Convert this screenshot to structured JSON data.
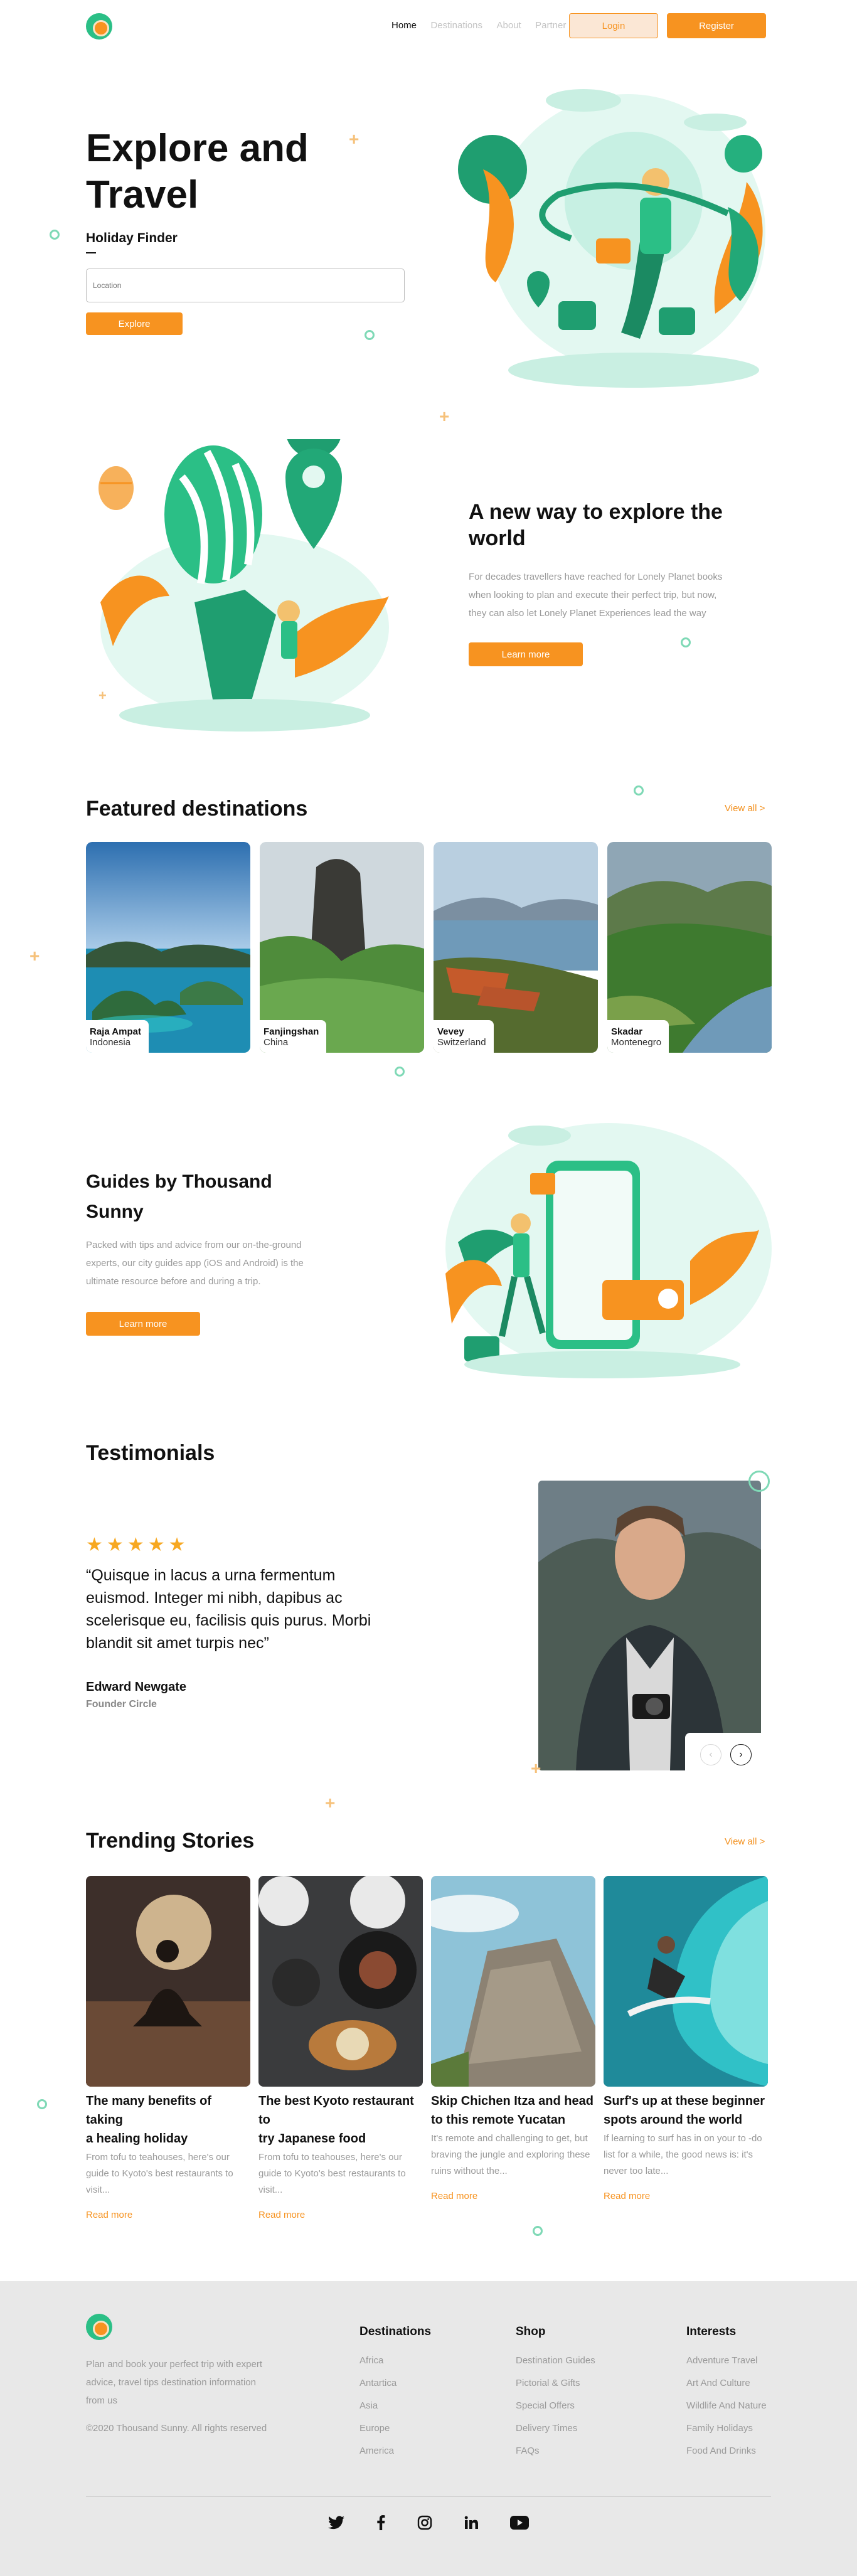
{
  "header": {
    "nav": [
      "Home",
      "Destinations",
      "About",
      "Partner"
    ],
    "login": "Login",
    "register": "Register"
  },
  "hero": {
    "title_line1": "Explore and",
    "title_line2": "Travel",
    "subtitle": "Holiday Finder",
    "location_placeholder": "Location",
    "explore_button": "Explore"
  },
  "new_way": {
    "title_line1": "A new way to explore the",
    "title_line2": "world",
    "body_line1": "For decades travellers have reached for Lonely Planet books",
    "body_line2": "when looking to plan and execute their perfect trip, but now,",
    "body_line3": "they can also let Lonely Planet Experiences lead the way",
    "button": "Learn more"
  },
  "featured": {
    "title": "Featured destinations",
    "view_all": "View all >",
    "cards": [
      {
        "name": "Raja Ampat",
        "country": "Indonesia"
      },
      {
        "name": "Fanjingshan",
        "country": "China"
      },
      {
        "name": "Vevey",
        "country": "Switzerland"
      },
      {
        "name": "Skadar",
        "country": "Montenegro"
      }
    ]
  },
  "guides": {
    "title_line1": "Guides by Thousand",
    "title_line2": "Sunny",
    "body_line1": "Packed with tips and advice from our on-the-ground",
    "body_line2": "experts, our city guides app (iOS and Android) is the",
    "body_line3": "ultimate resource before and during a trip.",
    "button": "Learn more"
  },
  "testimonials": {
    "title": "Testimonials",
    "rating": 5,
    "quote_line1": "“Quisque in lacus a urna fermentum",
    "quote_line2": "euismod. Integer mi nibh, dapibus ac",
    "quote_line3": "scelerisque eu, facilisis quis purus. Morbi",
    "quote_line4": "blandit sit amet turpis nec”",
    "author": "Edward Newgate",
    "role": "Founder Circle"
  },
  "trending": {
    "title": "Trending Stories",
    "view_all": "View all >",
    "stories": [
      {
        "title_line1": "The many benefits of taking",
        "title_line2": "a healing holiday",
        "ex1": "From tofu to teahouses, here's our",
        "ex2": "guide to Kyoto's best restaurants to",
        "ex3": "visit...",
        "read_more": "Read more"
      },
      {
        "title_line1": "The best Kyoto restaurant to",
        "title_line2": "try Japanese food",
        "ex1": "From tofu to teahouses, here's our",
        "ex2": "guide to Kyoto's best restaurants to",
        "ex3": "visit...",
        "read_more": "Read more"
      },
      {
        "title_line1": "Skip Chichen Itza and head",
        "title_line2": "to this remote Yucatan",
        "ex1": "It's remote and challenging to get, but",
        "ex2": "braving the jungle and exploring these",
        "ex3": "ruins without the...",
        "read_more": "Read more"
      },
      {
        "title_line1": "Surf's up at these beginner",
        "title_line2": "spots around the world",
        "ex1": "If learning to surf has in on your to -do",
        "ex2": "list for a while, the good news is: it's",
        "ex3": "never too late...",
        "read_more": "Read more"
      }
    ]
  },
  "footer": {
    "about_line1": "Plan and book your perfect trip with expert",
    "about_line2": "advice, travel tips destination information",
    "about_line3": "from us",
    "copyright": "©2020 Thousand Sunny. All rights reserved",
    "destinations": {
      "title": "Destinations",
      "links": [
        "Africa",
        "Antartica",
        "Asia",
        "Europe",
        "America"
      ]
    },
    "shop": {
      "title": "Shop",
      "links": [
        "Destination Guides",
        "Pictorial & Gifts",
        "Special Offers",
        "Delivery Times",
        "FAQs"
      ]
    },
    "interests": {
      "title": "Interests",
      "links": [
        "Adventure Travel",
        "Art And Culture",
        "Wildlife And Nature",
        "Family Holidays",
        "Food And Drinks"
      ]
    },
    "social": [
      "twitter-icon",
      "facebook-icon",
      "instagram-icon",
      "linkedin-icon",
      "youtube-icon"
    ]
  },
  "colors": {
    "accent": "#f79320",
    "green": "#2bbf86",
    "footer_bg": "#e8e8e8"
  }
}
